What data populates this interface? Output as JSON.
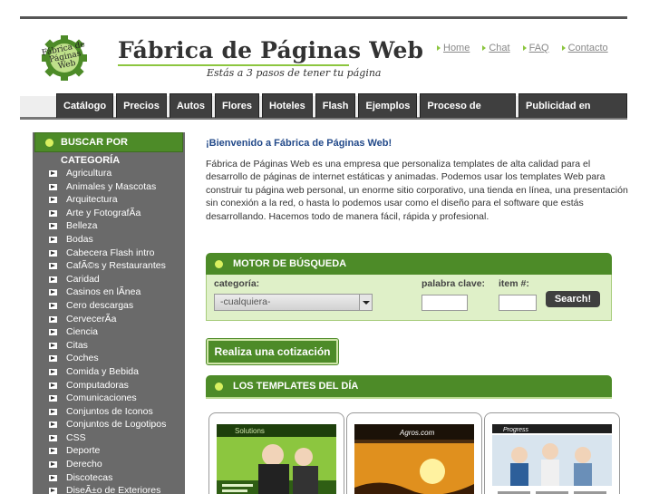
{
  "header": {
    "logo_text": "Fábrica de Páginas Web",
    "site_title": "Fábrica de Páginas Web",
    "tagline": "Estás a 3 pasos de tener tu página"
  },
  "toplinks": [
    {
      "label": "Home"
    },
    {
      "label": "Chat"
    },
    {
      "label": "FAQ"
    },
    {
      "label": "Contacto"
    }
  ],
  "nav": [
    {
      "label": "Catálogo"
    },
    {
      "label": "Precios"
    },
    {
      "label": "Autos"
    },
    {
      "label": "Flores"
    },
    {
      "label": "Hoteles"
    },
    {
      "label": "Flash"
    },
    {
      "label": "Ejemplos"
    },
    {
      "label": "Proceso de trabajo"
    },
    {
      "label": "Publicidad en internet"
    }
  ],
  "sidebar": {
    "title": "BUSCAR POR CATEGORÍA",
    "items": [
      "Agricultura",
      "Animales y Mascotas",
      "Arquitectura",
      "Arte y FotografÃ­a",
      "Belleza",
      "Bodas",
      "Cabecera Flash intro",
      "CafÃ©s y Restaurantes",
      "Caridad",
      "Casinos en lÃ­nea",
      "Cero descargas",
      "CervecerÃ­a",
      "Ciencia",
      "Citas",
      "Coches",
      "Comida y Bebida",
      "Computadoras",
      "Comunicaciones",
      "Conjuntos de Iconos",
      "Conjuntos de Logotipos",
      "CSS",
      "Deporte",
      "Derecho",
      "Discotecas",
      "DiseÃ±o de Exteriores"
    ]
  },
  "main": {
    "welcome": "¡Bienvenido a Fábrica de Páginas Web!",
    "intro": "Fábrica de Páginas Web es una empresa que personaliza templates de alta calidad para el desarrollo de páginas de internet estáticas y animadas. Podemos usar los templates Web para construir tu página web personal, un enorme sitio corporativo, una tienda en línea, una presentación sin conexión a la red, o hasta lo podemos usar como el diseño para el software que estás desarrollando. Hacemos todo de manera fácil, rápida y profesional."
  },
  "search": {
    "title": "MOTOR DE BÚSQUEDA",
    "category_label": "categoría:",
    "category_value": "-cualquiera-",
    "keyword_label": "palabra clave:",
    "item_label": "item #:",
    "button": "Search!"
  },
  "quote_button": "Realiza una cotización",
  "templates": {
    "title": "LOS TEMPLATES DEL DÍA",
    "thumbs": [
      {
        "caption": "Solutions"
      },
      {
        "caption": "Agros.com"
      },
      {
        "caption": "Progress"
      }
    ]
  },
  "colors": {
    "accent_green": "#4d8b28",
    "dark_tab": "#3f3f3f",
    "sidebar_bg": "#6a6a6a",
    "welcome_blue": "#234a8a"
  }
}
